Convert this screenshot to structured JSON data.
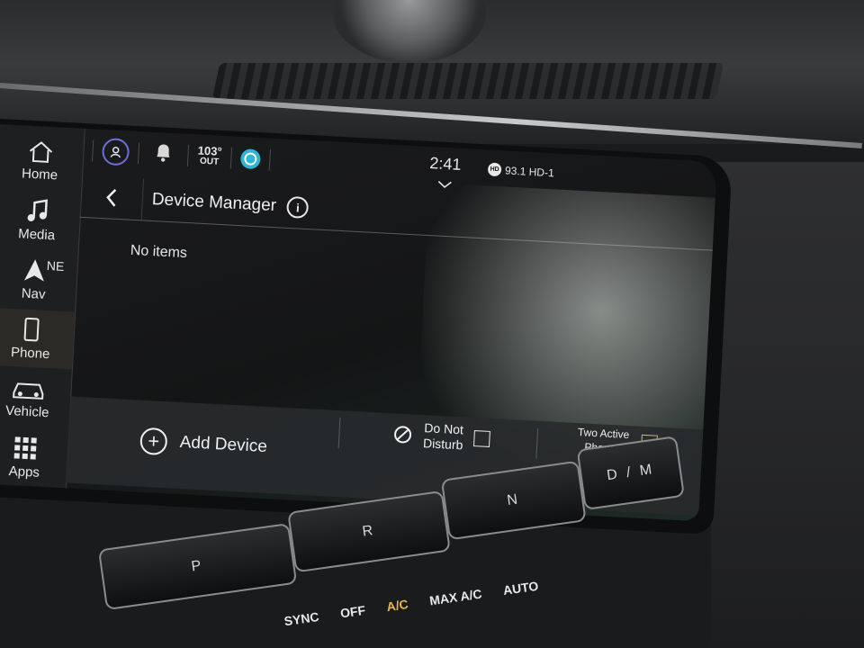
{
  "sidebar": {
    "items": [
      {
        "label": "Home",
        "icon": "home-icon",
        "active": false
      },
      {
        "label": "Media",
        "icon": "music-note-icon",
        "active": false
      },
      {
        "label": "Nav",
        "icon": "nav-arrow-icon",
        "active": false,
        "sub": "NE"
      },
      {
        "label": "Phone",
        "icon": "phone-icon",
        "active": true
      },
      {
        "label": "Vehicle",
        "icon": "car-icon",
        "active": false
      },
      {
        "label": "Apps",
        "icon": "apps-grid-icon",
        "active": false
      }
    ]
  },
  "status_bar": {
    "temperature": "103°",
    "temperature_sub": "OUT",
    "time": "2:41",
    "radio": "93.1 HD-1",
    "hd_badge": "HD"
  },
  "title_bar": {
    "title": "Device Manager",
    "info_symbol": "i"
  },
  "content": {
    "empty_text": "No items"
  },
  "bottom_bar": {
    "add_device": "Add Device",
    "dnd_line1": "Do Not",
    "dnd_line2": "Disturb",
    "dnd_checked": false,
    "two_phones_line1": "Two Active",
    "two_phones_line2": "Phones",
    "two_phones_checked": true,
    "check_mark": "✓"
  },
  "shifter": {
    "gears": [
      "P",
      "R",
      "N",
      "D / M"
    ]
  },
  "climate": {
    "sync": "SYNC",
    "off": "OFF",
    "ac": "A/C",
    "max_ac": "MAX A/C",
    "auto": "AUTO"
  },
  "colors": {
    "accent_gold": "#d6b25a",
    "active_tab": "#b09766",
    "screen_bg": "#141516"
  }
}
